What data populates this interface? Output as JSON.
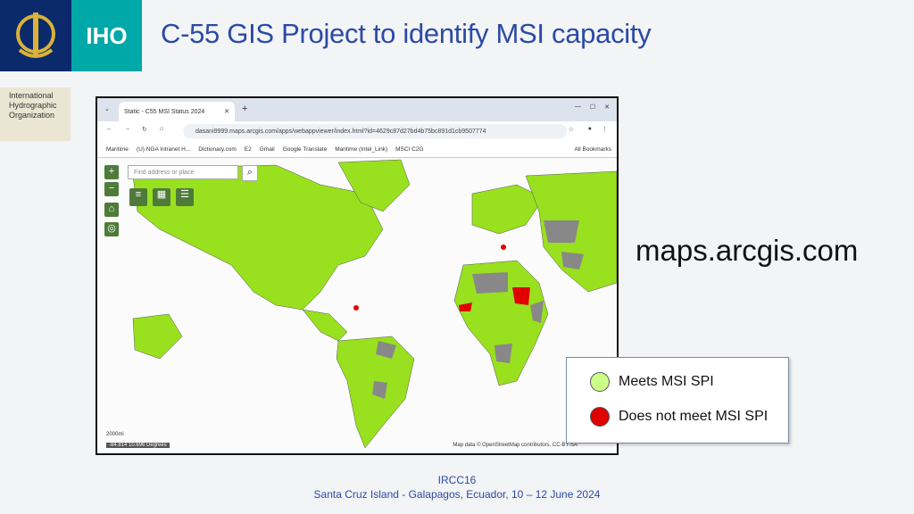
{
  "header": {
    "iho_label": "IHO",
    "org_name": [
      "International",
      "Hydrographic",
      "Organization"
    ],
    "title": "C-55 GIS Project to identify MSI capacity"
  },
  "browser": {
    "tab_title": "Static - C55 MSI Status 2024",
    "url": "dasani9999.maps.arcgis.com/apps/webappviewer/index.html?id=4629c87d27bd4b75bc891d1cb9507774",
    "bookmarks": [
      "Maritime",
      "(U) NGA Intranet H...",
      "Dictionary.com",
      "E2",
      "Gmail",
      "Google Translate",
      "Maritime (Intel_Link)",
      "MSCI C2G",
      "All Bookmarks"
    ],
    "map_search_placeholder": "Find address or place",
    "scale_label": "2000mi",
    "coords": "-84.814 10.696 Degrees",
    "attribution": "Map data © OpenStreetMap contributors, CC-BY-SA"
  },
  "side_label": "maps.arcgis.com",
  "legend": {
    "items": [
      {
        "label": "Meets MSI SPI",
        "color": "#ccff88"
      },
      {
        "label": "Does not meet MSI SPI",
        "color": "#e00000"
      }
    ]
  },
  "colors": {
    "meets": "#99e01f",
    "not_covered": "#888888",
    "not_meet": "#e00000"
  },
  "footer": {
    "line1": "IRCC16",
    "line2": "Santa Cruz Island - Galapagos, Ecuador, 10 – 12 June 2024"
  }
}
